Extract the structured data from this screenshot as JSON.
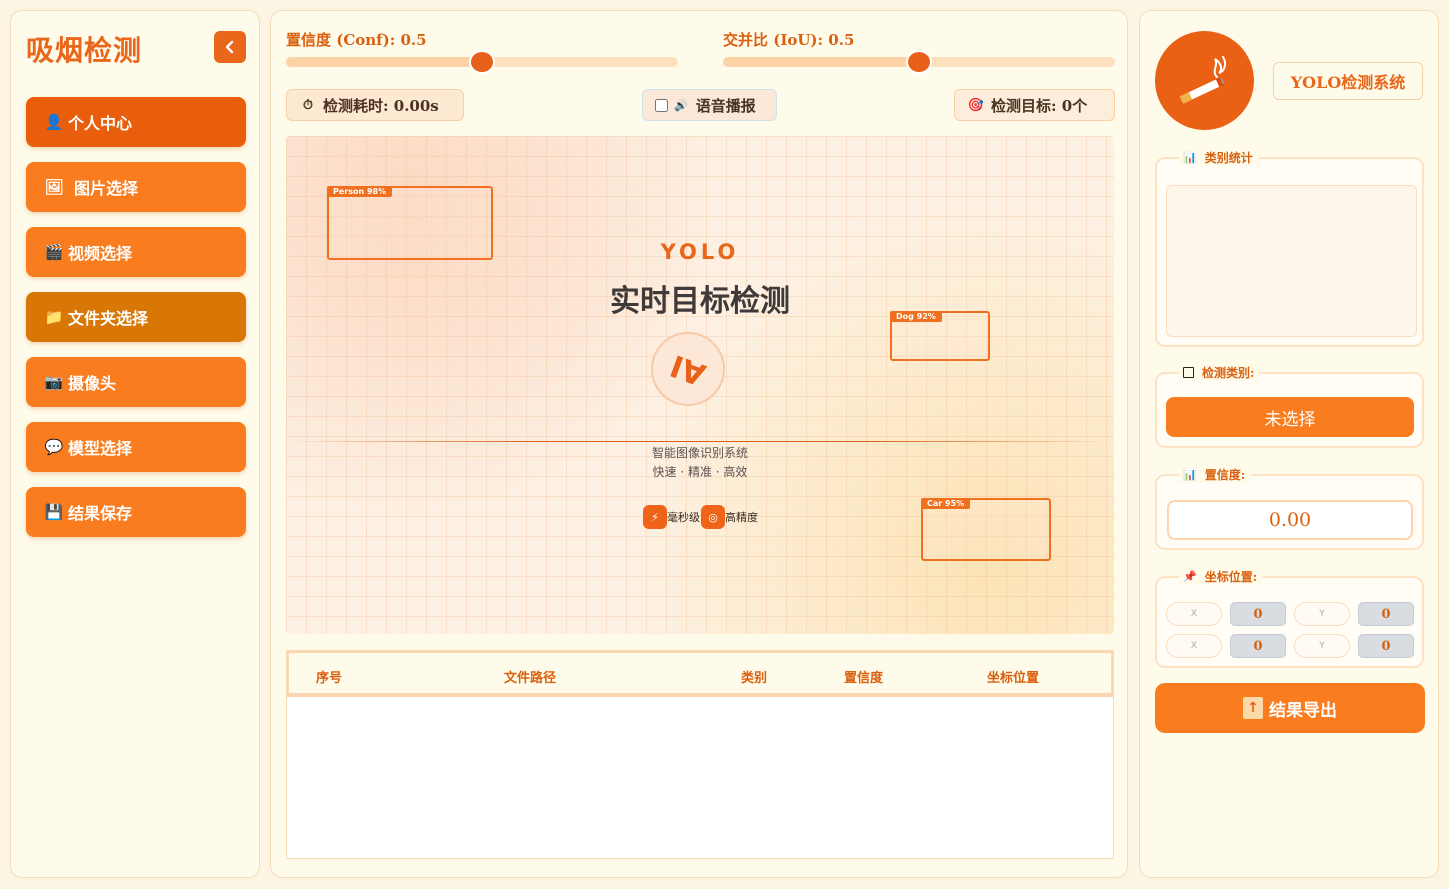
{
  "sidebar": {
    "title": "吸烟检测",
    "collapse_icon": "chevron-left-icon",
    "items": [
      {
        "label": "个人中心",
        "icon": "👤"
      },
      {
        "label": "图片选择",
        "icon": "🖼"
      },
      {
        "label": "视频选择",
        "icon": "🎬"
      },
      {
        "label": "文件夹选择",
        "icon": "📁"
      },
      {
        "label": "摄像头",
        "icon": "📷"
      },
      {
        "label": "模型选择",
        "icon": "💬"
      },
      {
        "label": "结果保存",
        "icon": "💾"
      }
    ]
  },
  "controls": {
    "conf_label": "置信度 (Conf): 0.5",
    "conf_value": 0.5,
    "iou_label": "交并比 (IoU): 0.5",
    "iou_value": 0.5,
    "time_label": "检测耗时: 0.00s",
    "voice_label": "语音播报",
    "target_label": "检测目标: 0个"
  },
  "preview": {
    "heading": "YOLO",
    "main_title": "实时目标检测",
    "ai_text": "AI",
    "subtitle": "智能图像识别系统",
    "tagline": "快速 · 精准 · 高效",
    "feature1": "毫秒级",
    "feature2": "高精度",
    "boxes": [
      {
        "label": "Person 98%"
      },
      {
        "label": "Dog 92%"
      },
      {
        "label": "Car 95%"
      }
    ]
  },
  "table": {
    "headers": [
      "序号",
      "文件路径",
      "类别",
      "置信度",
      "坐标位置"
    ],
    "rows": []
  },
  "right": {
    "system_tag": "YOLO检测系统",
    "category_stats_title": "类别统计",
    "detect_class_title": "检测类别:",
    "detect_class_value": "未选择",
    "confidence_title": "置信度:",
    "confidence_value": "0.00",
    "coord_title": "坐标位置:",
    "coords": {
      "x1_label": "X",
      "x1": "0",
      "y1_label": "Y",
      "y1": "0",
      "x2_label": "X",
      "x2": "0",
      "y2_label": "Y",
      "y2": "0"
    },
    "export_label": "结果导出"
  },
  "colors": {
    "accent": "#f97d1e",
    "accent_dark": "#e8611a",
    "folder": "#d97706",
    "background": "#fdf5e4"
  }
}
